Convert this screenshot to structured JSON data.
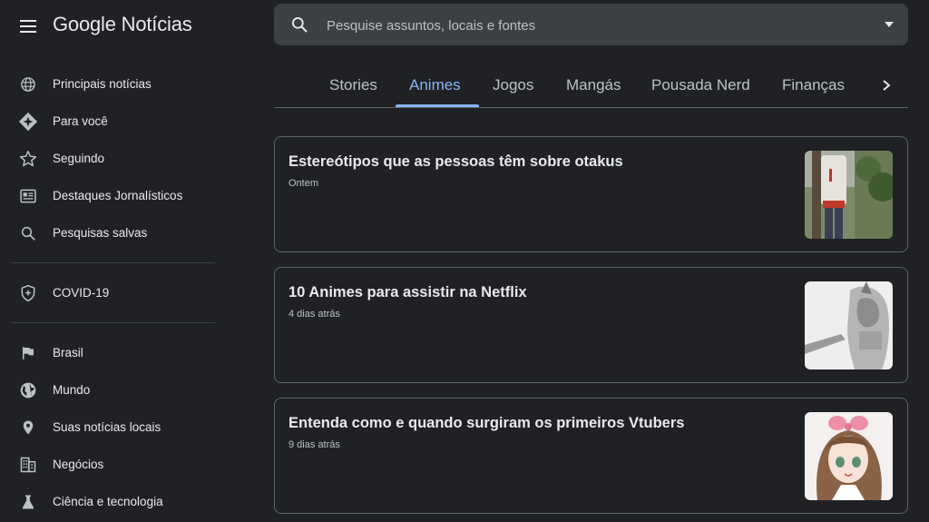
{
  "header": {
    "app_title": "Google Notícias",
    "search_placeholder": "Pesquise assuntos, locais e fontes"
  },
  "sidebar": {
    "items": [
      {
        "label": "Principais notícias",
        "icon": "globe-icon"
      },
      {
        "label": "Para você",
        "icon": "spark-diamond-icon"
      },
      {
        "label": "Seguindo",
        "icon": "star-icon"
      },
      {
        "label": "Destaques Jornalísticos",
        "icon": "newspaper-icon"
      },
      {
        "label": "Pesquisas salvas",
        "icon": "search-icon"
      }
    ],
    "covid": {
      "label": "COVID-19",
      "icon": "shield-icon"
    },
    "sections": [
      {
        "label": "Brasil",
        "icon": "flag-icon"
      },
      {
        "label": "Mundo",
        "icon": "earth-icon"
      },
      {
        "label": "Suas notícias locais",
        "icon": "location-pin-icon"
      },
      {
        "label": "Negócios",
        "icon": "building-icon"
      },
      {
        "label": "Ciência e tecnologia",
        "icon": "flask-icon"
      }
    ]
  },
  "tabs": [
    {
      "label": "Stories",
      "active": false
    },
    {
      "label": "Animes",
      "active": true
    },
    {
      "label": "Jogos",
      "active": false
    },
    {
      "label": "Mangás",
      "active": false
    },
    {
      "label": "Pousada Nerd",
      "active": false
    },
    {
      "label": "Finanças",
      "active": false
    }
  ],
  "articles": [
    {
      "title": "Estereótipos que as pessoas têm sobre otakus",
      "time": "Ontem"
    },
    {
      "title": "10 Animes para assistir na Netflix",
      "time": "4 dias atrás"
    },
    {
      "title": "Entenda como e quando surgiram os primeiros Vtubers",
      "time": "9 dias atrás"
    }
  ],
  "colors": {
    "background": "#202124",
    "accent": "#8ab4f8",
    "text": "#e8eaed",
    "border": "#5f6368"
  }
}
